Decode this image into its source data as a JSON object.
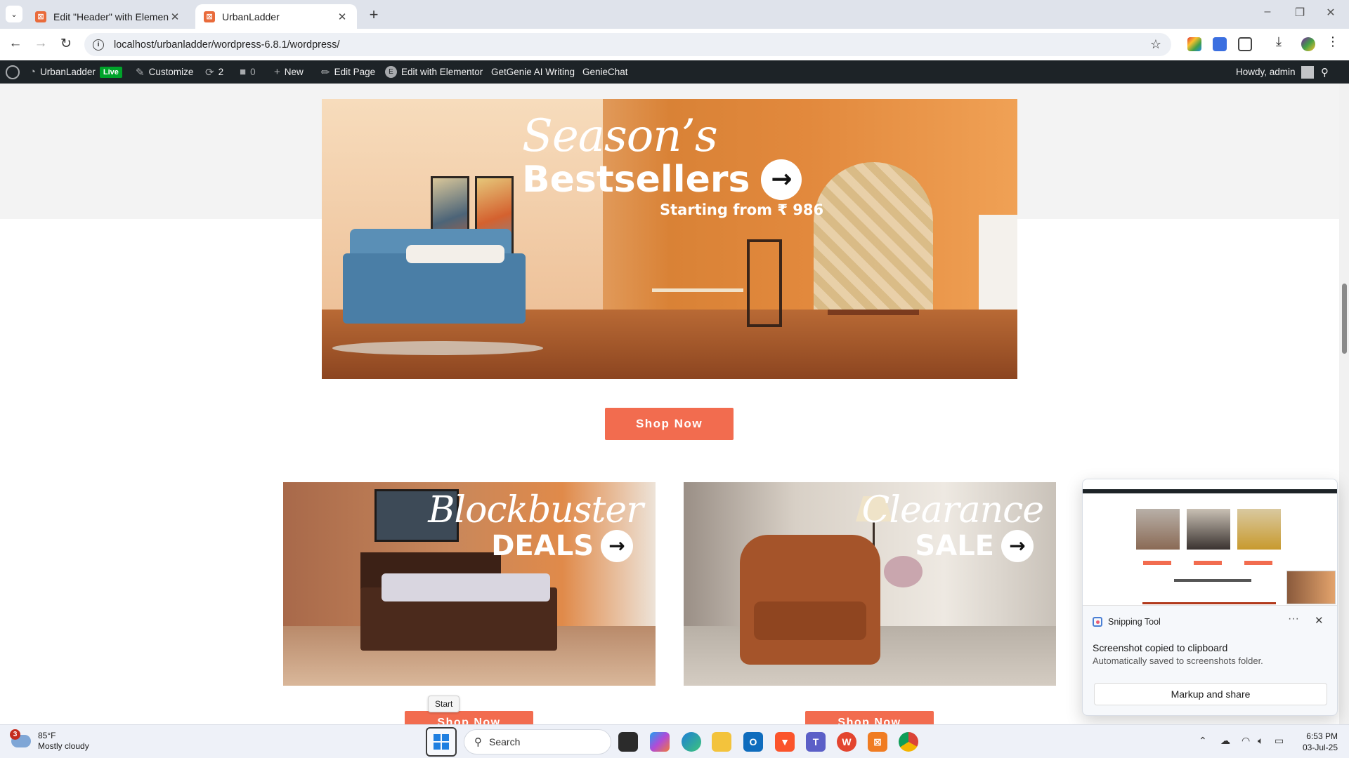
{
  "browser": {
    "tabs": [
      {
        "title": "Edit \"Header\" with Elementor",
        "active": false
      },
      {
        "title": "UrbanLadder",
        "active": true
      }
    ],
    "url": "localhost/urbanladder/wordpress-6.8.1/wordpress/",
    "new_tab_glyph": "+",
    "window_controls": [
      "–",
      "❐",
      "✕"
    ]
  },
  "adminbar": {
    "site_name": "UrbanLadder",
    "live_label": "Live",
    "customize": "Customize",
    "updates_count": "2",
    "comments_count": "0",
    "new_label": "New",
    "edit_page": "Edit Page",
    "edit_elementor": "Edit with Elementor",
    "getgenie": "GetGenie AI Writing",
    "geniechat": "GenieChat",
    "howdy": "Howdy, admin"
  },
  "hero": {
    "script": "Season’s",
    "headline": "Bestsellers",
    "sub": "Starting from ₹ 986",
    "cta": "Shop Now"
  },
  "promos": [
    {
      "script": "Blockbuster",
      "headline": "DEALS",
      "cta": "Shop Now"
    },
    {
      "script": "Clearance",
      "headline": "SALE",
      "cta": "Shop Now"
    }
  ],
  "tooltip": "Start",
  "notification": {
    "app": "Snipping Tool",
    "title": "Screenshot copied to clipboard",
    "body": "Automatically saved to screenshots folder.",
    "action": "Markup and share",
    "more_glyph": "···",
    "close_glyph": "✕"
  },
  "taskbar": {
    "weather_temp": "85°F",
    "weather_desc": "Mostly cloudy",
    "weather_badge": "3",
    "search_placeholder": "Search",
    "time": "6:53 PM",
    "date": "03-Jul-25"
  },
  "colors": {
    "accent": "#f26c4f",
    "wp_bar": "#1d2327",
    "live_badge": "#00a32a"
  }
}
